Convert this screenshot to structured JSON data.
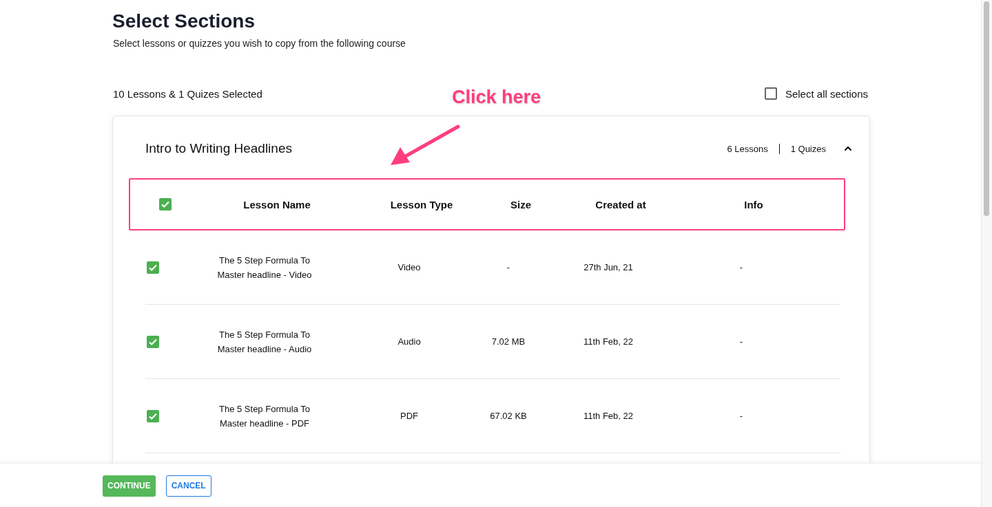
{
  "page": {
    "title": "Select Sections",
    "subtitle": "Select lessons or quizzes you wish to copy from the following course"
  },
  "summary": "10 Lessons & 1 Quizes Selected",
  "select_all": {
    "label": "Select all sections",
    "checked": false
  },
  "annotation": {
    "label": "Click here"
  },
  "section": {
    "title": "Intro to Writing Headlines",
    "lessons_count": "6 Lessons",
    "quizzes_count": "1 Quizes",
    "expanded": true,
    "header_checked": true,
    "columns": [
      "Lesson Name",
      "Lesson Type",
      "Size",
      "Created at",
      "Info"
    ],
    "rows": [
      {
        "checked": true,
        "lesson_name": "The 5 Step Formula To Master headline - Video",
        "lesson_type": "Video",
        "size": "-",
        "created_at": "27th Jun, 21",
        "info": "-"
      },
      {
        "checked": true,
        "lesson_name": "The 5 Step Formula To Master headline - Audio",
        "lesson_type": "Audio",
        "size": "7.02 MB",
        "created_at": "11th Feb, 22",
        "info": "-"
      },
      {
        "checked": true,
        "lesson_name": "The 5 Step Formula To Master headline - PDF",
        "lesson_type": "PDF",
        "size": "67.02 KB",
        "created_at": "11th Feb, 22",
        "info": "-"
      }
    ]
  },
  "buttons": [
    {
      "label": "CONTINUE",
      "kind": "primary"
    },
    {
      "label": "CANCEL",
      "kind": "secondary"
    }
  ]
}
